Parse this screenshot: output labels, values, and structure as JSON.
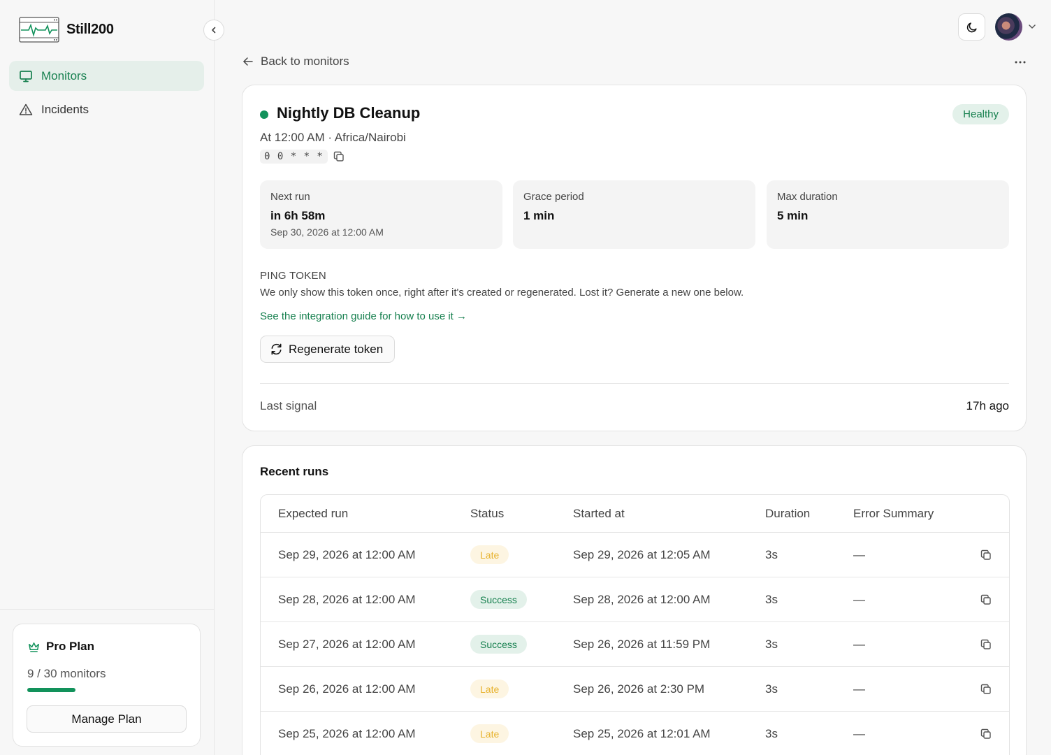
{
  "app": {
    "name": "Still200"
  },
  "sidebar": {
    "items": [
      {
        "label": "Monitors",
        "icon": "monitor-icon",
        "active": true
      },
      {
        "label": "Incidents",
        "icon": "alert-triangle-icon",
        "active": false
      }
    ],
    "plan": {
      "title": "Pro Plan",
      "usage": "9 / 30 monitors",
      "used": 9,
      "limit": 30,
      "button": "Manage Plan"
    }
  },
  "nav": {
    "back_label": "Back to monitors"
  },
  "monitor": {
    "title": "Nightly DB Cleanup",
    "status": "Healthy",
    "schedule": "At 12:00 AM · Africa/Nairobi",
    "cron": "0 0 * * *",
    "stats": {
      "next_run": {
        "label": "Next run",
        "value": "in 6h 58m",
        "sub": "Sep 30, 2026 at 12:00 AM"
      },
      "grace": {
        "label": "Grace period",
        "value": "1 min"
      },
      "max_duration": {
        "label": "Max duration",
        "value": "5 min"
      }
    },
    "ping": {
      "label": "PING TOKEN",
      "description": "We only show this token once, right after it's created or regenerated. Lost it? Generate a new one below.",
      "link": "See the integration guide for how to use it →",
      "regenerate": "Regenerate token"
    },
    "last_signal": {
      "label": "Last signal",
      "value": "17h ago"
    }
  },
  "runs": {
    "title": "Recent runs",
    "columns": [
      "Expected run",
      "Status",
      "Started at",
      "Duration",
      "Error Summary"
    ],
    "rows": [
      {
        "expected": "Sep 29, 2026 at 12:00 AM",
        "status": "Late",
        "started": "Sep 29, 2026 at 12:05 AM",
        "duration": "3s",
        "error": "—"
      },
      {
        "expected": "Sep 28, 2026 at 12:00 AM",
        "status": "Success",
        "started": "Sep 28, 2026 at 12:00 AM",
        "duration": "3s",
        "error": "—"
      },
      {
        "expected": "Sep 27, 2026 at 12:00 AM",
        "status": "Success",
        "started": "Sep 26, 2026 at 11:59 PM",
        "duration": "3s",
        "error": "—"
      },
      {
        "expected": "Sep 26, 2026 at 12:00 AM",
        "status": "Late",
        "started": "Sep 26, 2026 at 2:30 PM",
        "duration": "3s",
        "error": "—"
      },
      {
        "expected": "Sep 25, 2026 at 12:00 AM",
        "status": "Late",
        "started": "Sep 25, 2026 at 12:01 AM",
        "duration": "3s",
        "error": "—"
      }
    ]
  },
  "colors": {
    "accent": "#12925b",
    "late": "#e7b22d",
    "success_bg": "#e3f1ea"
  }
}
